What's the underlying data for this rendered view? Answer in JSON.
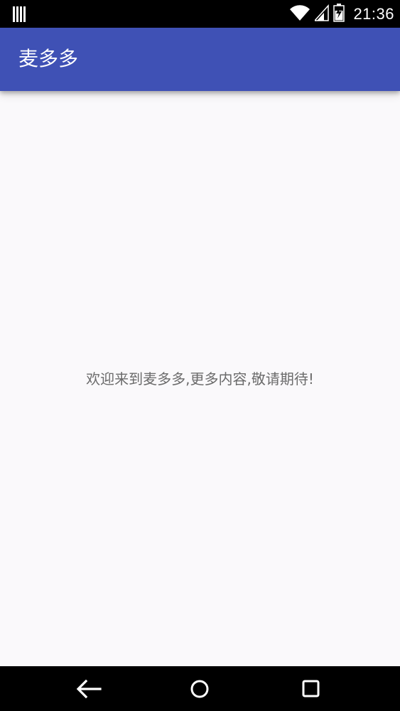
{
  "status_bar": {
    "time": "21:36",
    "icons": [
      "notification-icon",
      "wifi-icon",
      "signal-icon",
      "battery-icon"
    ]
  },
  "app_bar": {
    "title": "麦多多",
    "color": "#3f51b5"
  },
  "main": {
    "welcome_text": "欢迎来到麦多多,更多内容,敬请期待!"
  },
  "nav_bar": {
    "buttons": [
      "back-icon",
      "home-icon",
      "recents-icon"
    ]
  }
}
